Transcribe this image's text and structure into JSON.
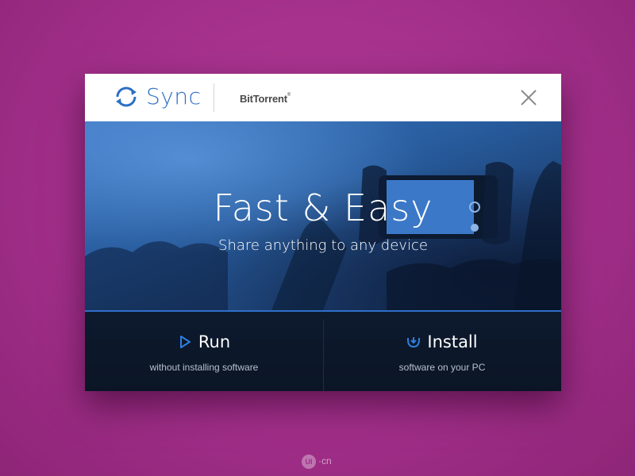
{
  "header": {
    "app_name": "Sync",
    "brand": "BitTorrent",
    "brand_mark": "®"
  },
  "hero": {
    "title": "Fast & Easy",
    "subtitle": "Share anything to any device"
  },
  "actions": {
    "run": {
      "label": "Run",
      "description": "without installing software",
      "icon": "play-icon"
    },
    "install": {
      "label": "Install",
      "description": "software on your PC",
      "icon": "install-icon"
    }
  },
  "watermark": {
    "badge": "UI",
    "text": "·cn"
  },
  "colors": {
    "accent": "#2f6fc9",
    "sync_blue": "#2d6fc4",
    "background": "#a22f8a",
    "actions_bg": "#0d1a2e"
  }
}
